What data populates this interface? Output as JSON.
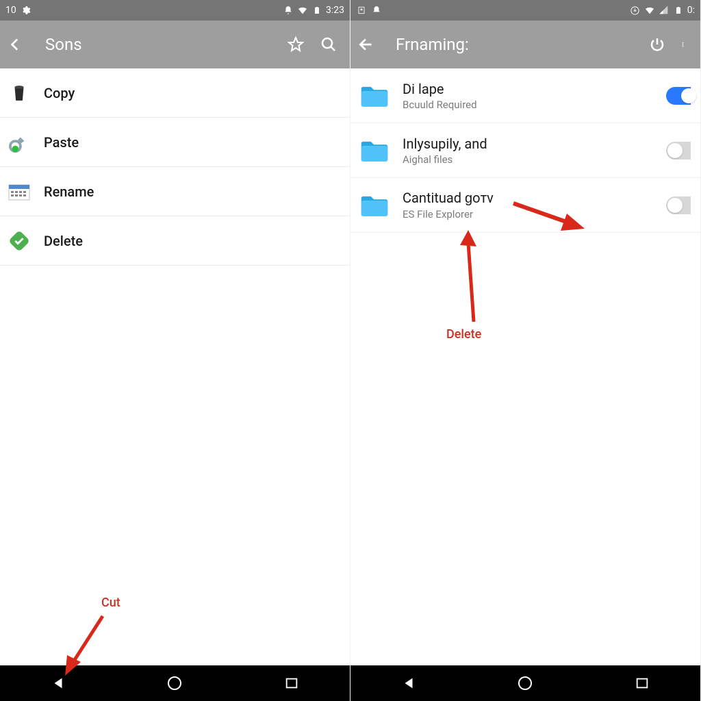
{
  "left": {
    "status": {
      "left_text": "10",
      "time": "3:23"
    },
    "appbar": {
      "title": "Sons"
    },
    "menu": [
      {
        "icon": "trash-icon",
        "label": "Copy"
      },
      {
        "icon": "link-icon",
        "label": "Paste"
      },
      {
        "icon": "calendar-icon",
        "label": "Rename"
      },
      {
        "icon": "delete-icon",
        "label": "Delete"
      }
    ],
    "annotation": "Cut"
  },
  "right": {
    "status": {
      "time": "0:"
    },
    "appbar": {
      "title": "Frnaming:"
    },
    "files": [
      {
        "title": "Di lape",
        "sub": "Bcuuld Required",
        "toggle": "on"
      },
      {
        "title": "Inlysupily, and",
        "sub": "Aighal files",
        "toggle": "off"
      },
      {
        "title": "Cantituad ɡoтv",
        "sub": "ES File Explorer",
        "toggle": "off"
      }
    ],
    "annotation": "Delete"
  },
  "colors": {
    "accent": "#2979ff",
    "anno": "#c83224"
  }
}
